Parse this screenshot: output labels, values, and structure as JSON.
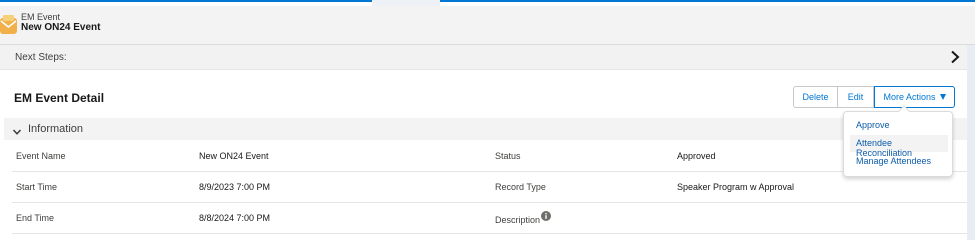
{
  "header": {
    "object_type": "EM Event",
    "record_name": "New ON24 Event",
    "icon": "em-event-icon"
  },
  "next_steps": {
    "label": "Next Steps:",
    "icon": "chevron-right-icon"
  },
  "detail": {
    "title": "EM Event Detail"
  },
  "actions": {
    "delete_label": "Delete",
    "edit_label": "Edit",
    "more_label": "More Actions",
    "menu": [
      {
        "label": "Approve"
      },
      {
        "label": "Attendee Reconciliation"
      },
      {
        "label": "Manage Attendees"
      }
    ]
  },
  "section": {
    "label": "Information",
    "icon": "chevron-down-icon"
  },
  "fields": [
    {
      "label_left": "Event Name",
      "value_left": "New ON24 Event",
      "label_right": "Status",
      "value_right": "Approved"
    },
    {
      "label_left": "Start Time",
      "value_left": "8/9/2023 7:00 PM",
      "label_right": "Record Type",
      "value_right": "Speaker Program w Approval"
    },
    {
      "label_left": "End Time",
      "value_left": "8/8/2024 7:00 PM",
      "label_right": "Description",
      "value_right": ""
    }
  ],
  "colors": {
    "brand": "#0176d3",
    "link": "#0b5cab",
    "header_bg": "#f3f3f3"
  }
}
